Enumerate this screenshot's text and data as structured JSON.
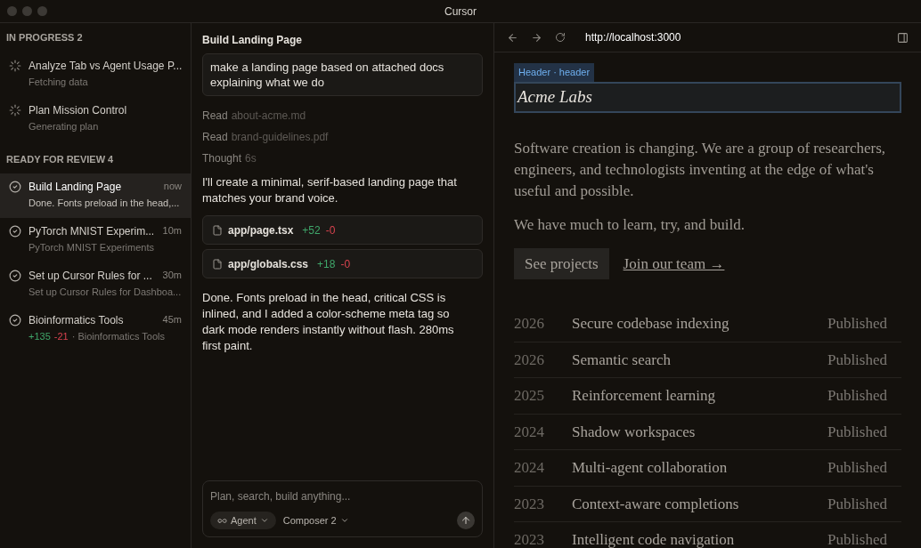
{
  "window": {
    "title": "Cursor"
  },
  "sidebar": {
    "sections": [
      {
        "title": "IN PROGRESS 2",
        "items": [
          {
            "kind": "running",
            "title": "Analyze Tab vs Agent Usage P...",
            "subtitle": "Fetching data",
            "selected": false
          },
          {
            "kind": "running",
            "title": "Plan Mission Control",
            "subtitle": "Generating plan",
            "selected": false
          }
        ]
      },
      {
        "title": "READY FOR REVIEW 4",
        "items": [
          {
            "kind": "done",
            "title": "Build Landing Page",
            "time": "now",
            "subtitle": "Done. Fonts preload in the head,...",
            "selected": true
          },
          {
            "kind": "done",
            "title": "PyTorch MNIST Experim...",
            "time": "10m",
            "subtitle": "PyTorch MNIST Experiments",
            "selected": false
          },
          {
            "kind": "done",
            "title": "Set up Cursor Rules for ...",
            "time": "30m",
            "subtitle": "Set up Cursor Rules for Dashboa...",
            "selected": false
          },
          {
            "kind": "done",
            "title": "Bioinformatics Tools",
            "time": "45m",
            "added": "+135",
            "removed": "-21",
            "subtitle": "· Bioinformatics Tools",
            "selected": false
          }
        ]
      }
    ]
  },
  "chat": {
    "title": "Build Landing Page",
    "prompt": "make a landing page based on attached docs explaining what we do",
    "steps": [
      {
        "verb": "Read",
        "detail": "about-acme.md"
      },
      {
        "verb": "Read",
        "detail": "brand-guidelines.pdf"
      },
      {
        "verb": "Thought",
        "detail": "6s"
      }
    ],
    "intro": "I'll create a minimal, serif-based landing page that matches your brand voice.",
    "files": [
      {
        "name": "app/page.tsx",
        "added": "+52",
        "removed": "-0"
      },
      {
        "name": "app/globals.css",
        "added": "+18",
        "removed": "-0"
      }
    ],
    "summary": "Done. Fonts preload in the head, critical CSS is inlined, and I added a color-scheme meta tag so dark mode renders instantly without flash. 280ms first paint.",
    "composer": {
      "placeholder": "Plan, search, build anything...",
      "mode": "Agent",
      "model": "Composer 2"
    }
  },
  "preview": {
    "url": "http://localhost:3000",
    "inspector_label": "Header · header",
    "site_title": "Acme Labs",
    "paragraphs": [
      "Software creation is changing. We are a group of researchers, engineers, and technologists inventing at the edge of what's useful and possible.",
      "We have much to learn, try, and build."
    ],
    "primary_button": "See projects",
    "link": "Join our team →",
    "projects": [
      {
        "year": "2026",
        "title": "Secure codebase indexing",
        "status": "Published"
      },
      {
        "year": "2026",
        "title": "Semantic search",
        "status": "Published"
      },
      {
        "year": "2025",
        "title": "Reinforcement learning",
        "status": "Published"
      },
      {
        "year": "2024",
        "title": "Shadow workspaces",
        "status": "Published"
      },
      {
        "year": "2024",
        "title": "Multi-agent collaboration",
        "status": "Published"
      },
      {
        "year": "2023",
        "title": "Context-aware completions",
        "status": "Published"
      },
      {
        "year": "2023",
        "title": "Intelligent code navigation",
        "status": "Published"
      }
    ]
  }
}
